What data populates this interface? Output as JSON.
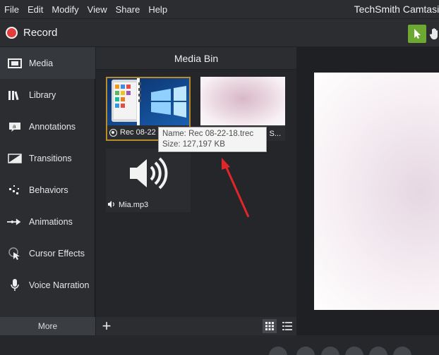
{
  "menu": [
    "File",
    "Edit",
    "Modify",
    "View",
    "Share",
    "Help"
  ],
  "app_title": "TechSmith Camtasia",
  "toolbar": {
    "record_label": "Record"
  },
  "sidebar": {
    "items": [
      {
        "label": "Media",
        "icon": "film-strip-icon"
      },
      {
        "label": "Library",
        "icon": "library-icon"
      },
      {
        "label": "Annotations",
        "icon": "annotation-icon"
      },
      {
        "label": "Transitions",
        "icon": "transition-icon"
      },
      {
        "label": "Behaviors",
        "icon": "behaviors-icon"
      },
      {
        "label": "Animations",
        "icon": "animation-icon"
      },
      {
        "label": "Cursor Effects",
        "icon": "cursor-effects-icon"
      },
      {
        "label": "Voice Narration",
        "icon": "microphone-icon"
      }
    ],
    "more_label": "More"
  },
  "media_bin": {
    "title": "Media Bin",
    "items": [
      {
        "caption": "Rec 08-22",
        "type": "recording",
        "icon": "record-icon"
      },
      {
        "caption": "",
        "type": "image"
      },
      {
        "caption": "Mia.mp3",
        "type": "audio",
        "icon": "speaker-icon"
      }
    ],
    "item2_partial": "...",
    "item2_partial_prefix": "S"
  },
  "tooltip": {
    "name_line": "Name: Rec 08-22-18.trec",
    "size_line": "Size: 127,197 KB"
  },
  "colors": {
    "record": "#e23c3c",
    "accent_green": "#6da832",
    "selection": "#b98a2a",
    "arrow": "#e0262b"
  }
}
